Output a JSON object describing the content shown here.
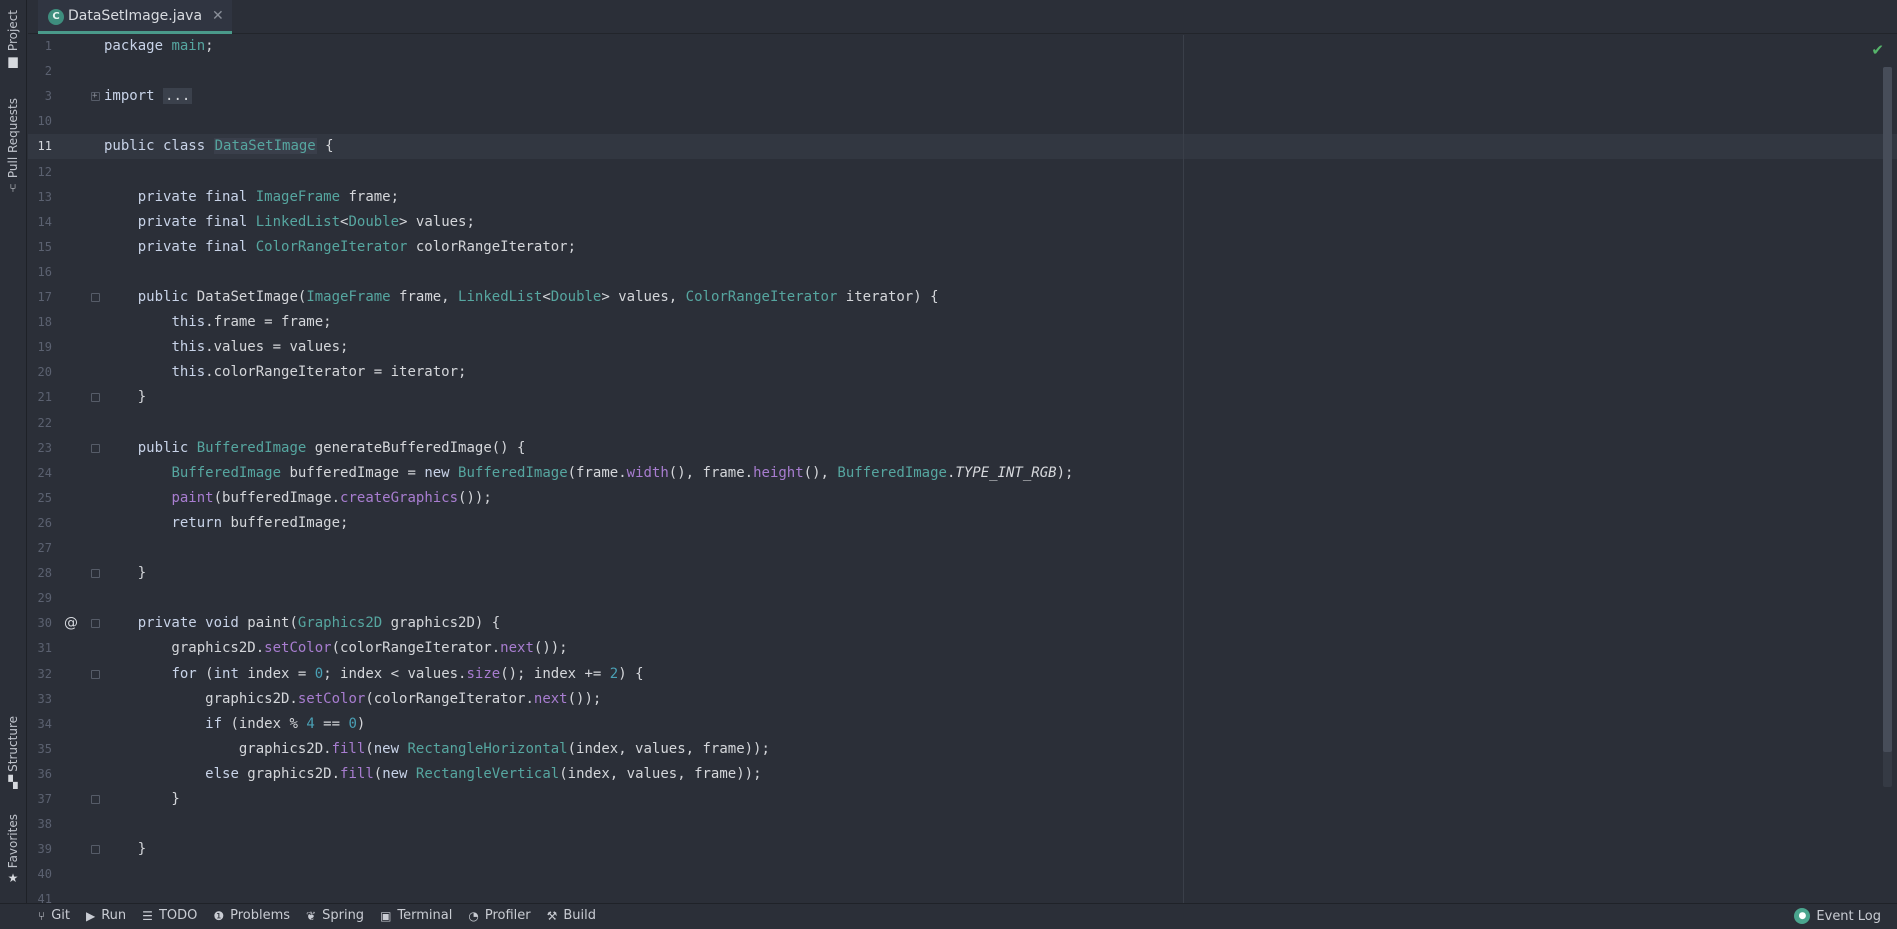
{
  "left_strip": {
    "project": "Project",
    "pull_requests": "Pull Requests",
    "structure": "Structure",
    "favorites": "Favorites"
  },
  "tab": {
    "label": "DataSetImage.java",
    "icon": "c-class-icon"
  },
  "colors": {
    "background": "#2b2f38",
    "type": "#56a6a0",
    "method": "#a87dd0",
    "number": "#4aa0b5",
    "accent": "#4a9a8a"
  },
  "editor": {
    "current_line": "11",
    "lines": [
      {
        "n": "1",
        "html": "<span class='kw'>package</span> <span class='ty'>main</span>;"
      },
      {
        "n": "2",
        "html": ""
      },
      {
        "n": "3",
        "html": "<span class='kw'>import</span> <span class='dots'>...</span>",
        "fold": "plus"
      },
      {
        "n": "10",
        "html": ""
      },
      {
        "n": "11",
        "html": "<span class='kw'>public class</span> <span class='hl'>DataSetImage</span> {",
        "current": true
      },
      {
        "n": "12",
        "html": ""
      },
      {
        "n": "13",
        "html": "    <span class='kw'>private final</span> <span class='ty'>ImageFrame</span> frame;"
      },
      {
        "n": "14",
        "html": "    <span class='kw'>private final</span> <span class='ty'>LinkedList</span>&lt;<span class='ty'>Double</span>&gt; values;"
      },
      {
        "n": "15",
        "html": "    <span class='kw'>private final</span> <span class='ty'>ColorRangeIterator</span> colorRangeIterator;"
      },
      {
        "n": "16",
        "html": ""
      },
      {
        "n": "17",
        "html": "    <span class='kw'>public</span> DataSetImage(<span class='ty'>ImageFrame</span> frame, <span class='ty'>LinkedList</span>&lt;<span class='ty'>Double</span>&gt; values, <span class='ty'>ColorRangeIterator</span> iterator) {",
        "fold": "minus"
      },
      {
        "n": "18",
        "html": "        <span class='kw'>this</span>.frame = frame;"
      },
      {
        "n": "19",
        "html": "        <span class='kw'>this</span>.values = values;"
      },
      {
        "n": "20",
        "html": "        <span class='kw'>this</span>.colorRangeIterator = iterator;"
      },
      {
        "n": "21",
        "html": "    }",
        "fold": "minus"
      },
      {
        "n": "22",
        "html": ""
      },
      {
        "n": "23",
        "html": "    <span class='kw'>public</span> <span class='ty'>BufferedImage</span> generateBufferedImage() {",
        "fold": "minus"
      },
      {
        "n": "24",
        "html": "        <span class='ty'>BufferedImage</span> bufferedImage = <span class='kw'>new</span> <span class='ty'>BufferedImage</span>(frame.<span class='fn'>width</span>(), frame.<span class='fn'>height</span>(), <span class='ty'>BufferedImage</span>.<span class='it'>TYPE_INT_RGB</span>);"
      },
      {
        "n": "25",
        "html": "        <span class='fn'>paint</span>(bufferedImage.<span class='fn'>createGraphics</span>());"
      },
      {
        "n": "26",
        "html": "        <span class='kw'>return</span> bufferedImage;"
      },
      {
        "n": "27",
        "html": ""
      },
      {
        "n": "28",
        "html": "    }",
        "fold": "minus"
      },
      {
        "n": "29",
        "html": ""
      },
      {
        "n": "30",
        "html": "    <span class='kw'>private void</span> paint(<span class='ty'>Graphics2D</span> graphics2D) {",
        "fold": "minus",
        "at": "@"
      },
      {
        "n": "31",
        "html": "        graphics2D.<span class='fn'>setColor</span>(colorRangeIterator.<span class='fn'>next</span>());"
      },
      {
        "n": "32",
        "html": "        <span class='kw'>for</span> (<span class='kw'>int</span> index = <span class='num'>0</span>; index &lt; values.<span class='fn'>size</span>(); index += <span class='num'>2</span>) {",
        "fold": "minus"
      },
      {
        "n": "33",
        "html": "            graphics2D.<span class='fn'>setColor</span>(colorRangeIterator.<span class='fn'>next</span>());"
      },
      {
        "n": "34",
        "html": "            <span class='kw'>if</span> (index % <span class='num'>4</span> == <span class='num'>0</span>)"
      },
      {
        "n": "35",
        "html": "                graphics2D.<span class='fn'>fill</span>(<span class='kw'>new</span> <span class='ty'>RectangleHorizontal</span>(index, values, frame));"
      },
      {
        "n": "36",
        "html": "            <span class='kw'>else</span> graphics2D.<span class='fn'>fill</span>(<span class='kw'>new</span> <span class='ty'>RectangleVertical</span>(index, values, frame));"
      },
      {
        "n": "37",
        "html": "        }",
        "fold": "minus"
      },
      {
        "n": "38",
        "html": ""
      },
      {
        "n": "39",
        "html": "    }",
        "fold": "minus"
      },
      {
        "n": "40",
        "html": ""
      },
      {
        "n": "41",
        "html": ""
      }
    ]
  },
  "status_bar": {
    "items": [
      {
        "label": "Git",
        "icon": "git-icon",
        "glyph": "⑂"
      },
      {
        "label": "Run",
        "icon": "run-icon",
        "glyph": "▶"
      },
      {
        "label": "TODO",
        "icon": "todo-icon",
        "glyph": "☰"
      },
      {
        "label": "Problems",
        "icon": "problems-icon",
        "glyph": "❶"
      },
      {
        "label": "Spring",
        "icon": "spring-icon",
        "glyph": "❦"
      },
      {
        "label": "Terminal",
        "icon": "terminal-icon",
        "glyph": "▣"
      },
      {
        "label": "Profiler",
        "icon": "profiler-icon",
        "glyph": "◔"
      },
      {
        "label": "Build",
        "icon": "build-icon",
        "glyph": "⚒"
      }
    ],
    "event_log": "Event Log"
  }
}
